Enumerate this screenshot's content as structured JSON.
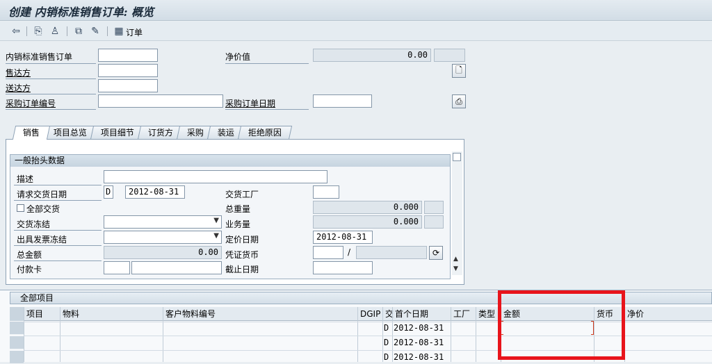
{
  "window": {
    "title": "创建 内销标准销售订单: 概览"
  },
  "toolbar": {
    "order_label": "订单"
  },
  "header": {
    "order_type_label": "内销标准销售订单",
    "net_value_label": "净价值",
    "net_value": "0.00",
    "sold_to_label": "售达方",
    "ship_to_label": "送达方",
    "po_number_label": "采购订单编号",
    "po_date_label": "采购订单日期"
  },
  "tabs": [
    "销售",
    "项目总览",
    "项目细节",
    "订货方",
    "采购",
    "装运",
    "拒绝原因"
  ],
  "general": {
    "group_title": "一般抬头数据",
    "description_label": "描述",
    "req_delivery_date_label": "请求交货日期",
    "req_delivery_date_flag": "D",
    "req_delivery_date": "2012-08-31",
    "delivery_plant_label": "交货工厂",
    "complete_delivery_label": "全部交货",
    "total_weight_label": "总重量",
    "total_weight": "0.000",
    "delivery_block_label": "交货冻结",
    "volume_label": "业务量",
    "volume": "0.000",
    "billing_block_label": "出具发票冻结",
    "pricing_date_label": "定价日期",
    "pricing_date": "2012-08-31",
    "total_amount_label": "总金额",
    "total_amount": "0.00",
    "doc_currency_label": "凭证货币",
    "currency_sep": "/",
    "payment_card_label": "付款卡",
    "expiry_date_label": "截止日期"
  },
  "items": {
    "section_title": "全部项目",
    "columns": [
      "项目",
      "物料",
      "客户物料编号",
      "DGIP",
      "交",
      "首个日期",
      "工厂",
      "类型",
      "金额",
      "货币",
      "净价"
    ],
    "rows": [
      {
        "d": "D",
        "date": "2012-08-31"
      },
      {
        "d": "D",
        "date": "2012-08-31"
      },
      {
        "d": "D",
        "date": "2012-08-31"
      }
    ]
  }
}
